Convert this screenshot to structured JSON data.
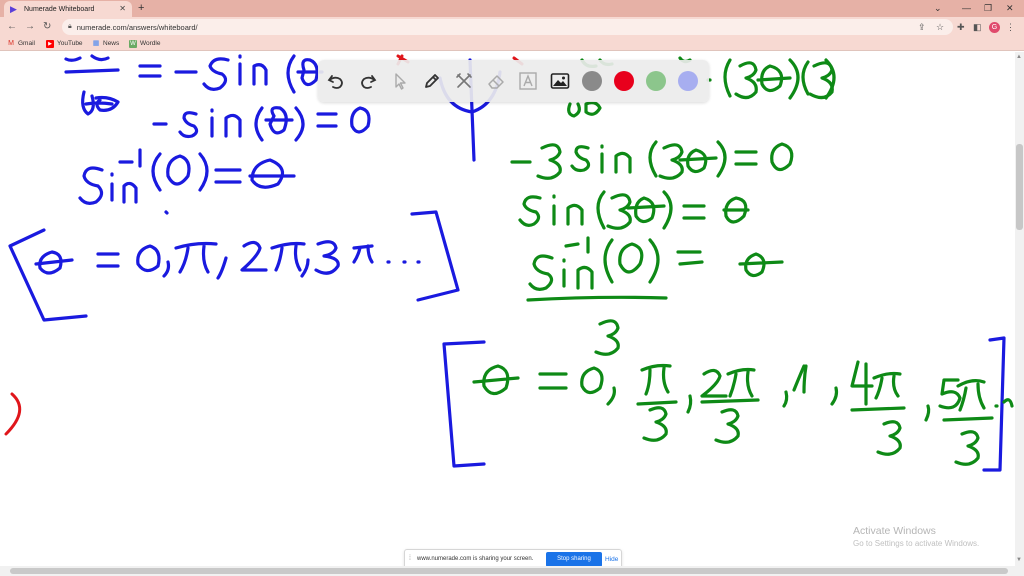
{
  "browser": {
    "tab_title": "Numerade Whiteboard",
    "url": "numerade.com/answers/whiteboard/",
    "avatar_letter": "G",
    "bookmarks": [
      {
        "label": "Gmail",
        "icon": "gmail-icon",
        "color": "#d93025"
      },
      {
        "label": "YouTube",
        "icon": "youtube-icon",
        "color": "#ff0000"
      },
      {
        "label": "News",
        "icon": "news-icon",
        "color": "#4285f4"
      },
      {
        "label": "Wordle",
        "icon": "wordle-icon",
        "color": "#6aaa64"
      }
    ]
  },
  "whiteboard": {
    "tools": [
      "undo-icon",
      "redo-icon",
      "pointer-icon",
      "pen-icon",
      "tools-icon",
      "eraser-icon",
      "text-icon",
      "image-icon"
    ],
    "colors": [
      "#8a8a8a",
      "#e8001c",
      "#8cc68c",
      "#a7aef0"
    ],
    "ink_colors": {
      "blue": "#1a1adf",
      "green": "#0e8a16",
      "red": "#e0161b"
    }
  },
  "watermark": {
    "line1": "Activate Windows",
    "line2": "Go to Settings to activate Windows."
  },
  "share_bar": {
    "message": "www.numerade.com is sharing your screen.",
    "stop_label": "Stop sharing",
    "hide_label": "Hide"
  }
}
